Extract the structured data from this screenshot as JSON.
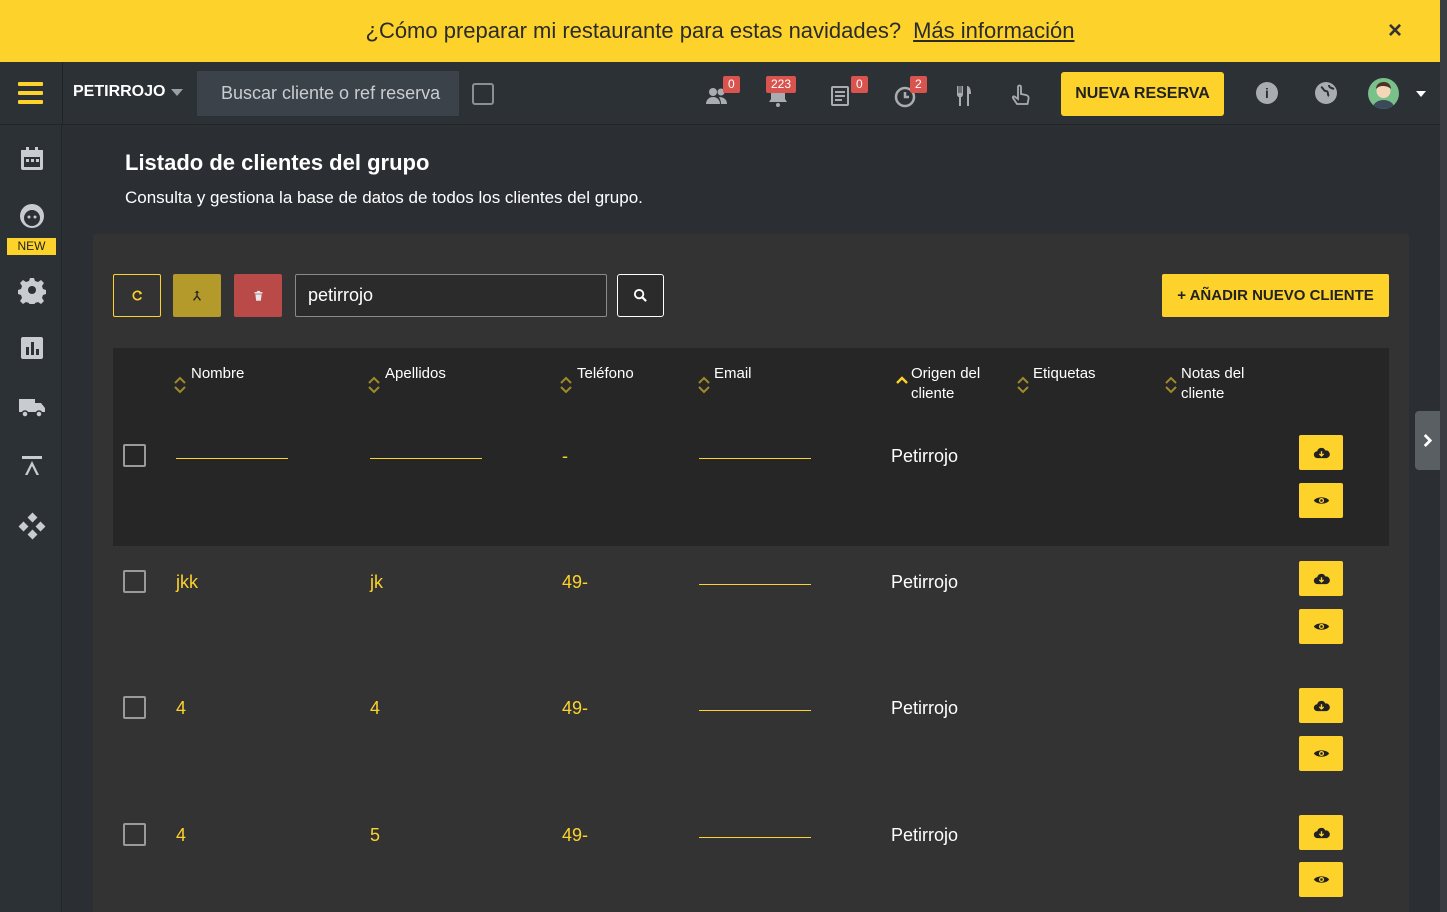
{
  "banner": {
    "text": "¿Cómo preparar mi restaurante para estas navidades?",
    "link": "Más información",
    "close": "×"
  },
  "topbar": {
    "group": "PETIRROJO",
    "search_placeholder": "Buscar cliente o ref reserva",
    "badges": {
      "customers": "0",
      "messages": "223",
      "news": "0",
      "pending": "2"
    },
    "new_reservation": "NUEVA RESERVA"
  },
  "sidebar": {
    "new_badge": "NEW"
  },
  "page": {
    "title": "Listado de clientes del grupo",
    "subtitle": "Consulta y gestiona la base de datos de todos los clientes del grupo."
  },
  "toolbar": {
    "filter_value": "petirrojo",
    "add_client": "+ AÑADIR NUEVO CLIENTE"
  },
  "table": {
    "columns": {
      "nombre": "Nombre",
      "apellidos": "Apellidos",
      "telefono": "Teléfono",
      "email": "Email",
      "origen": "Origen del cliente",
      "etiquetas": "Etiquetas",
      "notas": "Notas del cliente"
    },
    "rows": [
      {
        "nombre": "",
        "apellidos": "",
        "telefono": "-",
        "email": "",
        "origen": "Petirrojo"
      },
      {
        "nombre": "jkk",
        "apellidos": "jk",
        "telefono": "49-",
        "email": "",
        "origen": "Petirrojo"
      },
      {
        "nombre": "4",
        "apellidos": "4",
        "telefono": "49-",
        "email": "",
        "origen": "Petirrojo"
      },
      {
        "nombre": "4",
        "apellidos": "5",
        "telefono": "49-",
        "email": "",
        "origen": "Petirrojo"
      }
    ]
  },
  "colors": {
    "accent": "#fdd32b",
    "danger": "#b94a48",
    "panel": "#333333",
    "topbar": "#2c3136"
  }
}
